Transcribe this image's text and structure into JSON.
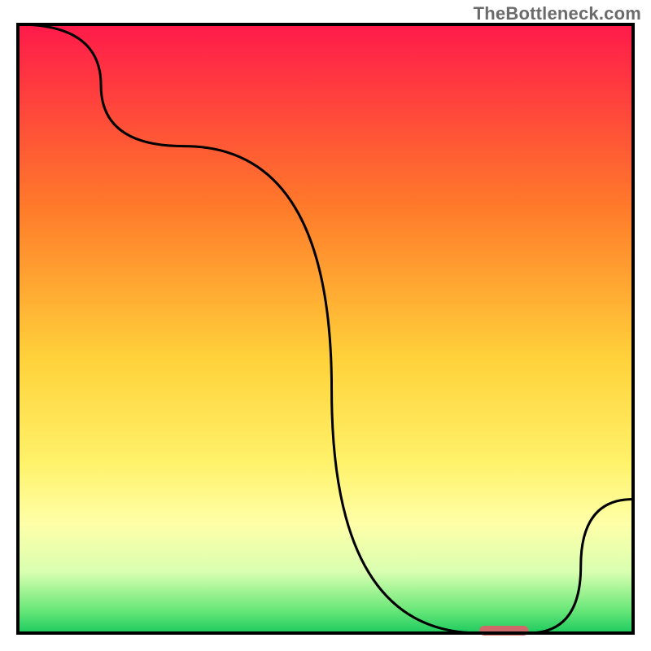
{
  "watermark": "TheBottleneck.com",
  "chart_data": {
    "type": "line",
    "title": "",
    "xlabel": "",
    "ylabel": "",
    "xlim": [
      0,
      100
    ],
    "ylim": [
      0,
      100
    ],
    "x": [
      0,
      27,
      75,
      83,
      100
    ],
    "values": [
      100,
      80,
      0,
      0,
      22
    ],
    "optimal_marker": {
      "x_start": 75,
      "x_end": 83,
      "y": 0,
      "color": "#d06a6a"
    },
    "gradient_stops": [
      {
        "offset": 0,
        "color": "#ff1a4a"
      },
      {
        "offset": 30,
        "color": "#ff7a2a"
      },
      {
        "offset": 55,
        "color": "#ffd23a"
      },
      {
        "offset": 72,
        "color": "#fff26a"
      },
      {
        "offset": 82,
        "color": "#ffffa8"
      },
      {
        "offset": 90,
        "color": "#d8ffb0"
      },
      {
        "offset": 96,
        "color": "#6de87a"
      },
      {
        "offset": 100,
        "color": "#1ecb5f"
      }
    ],
    "border_color": "#000000"
  }
}
